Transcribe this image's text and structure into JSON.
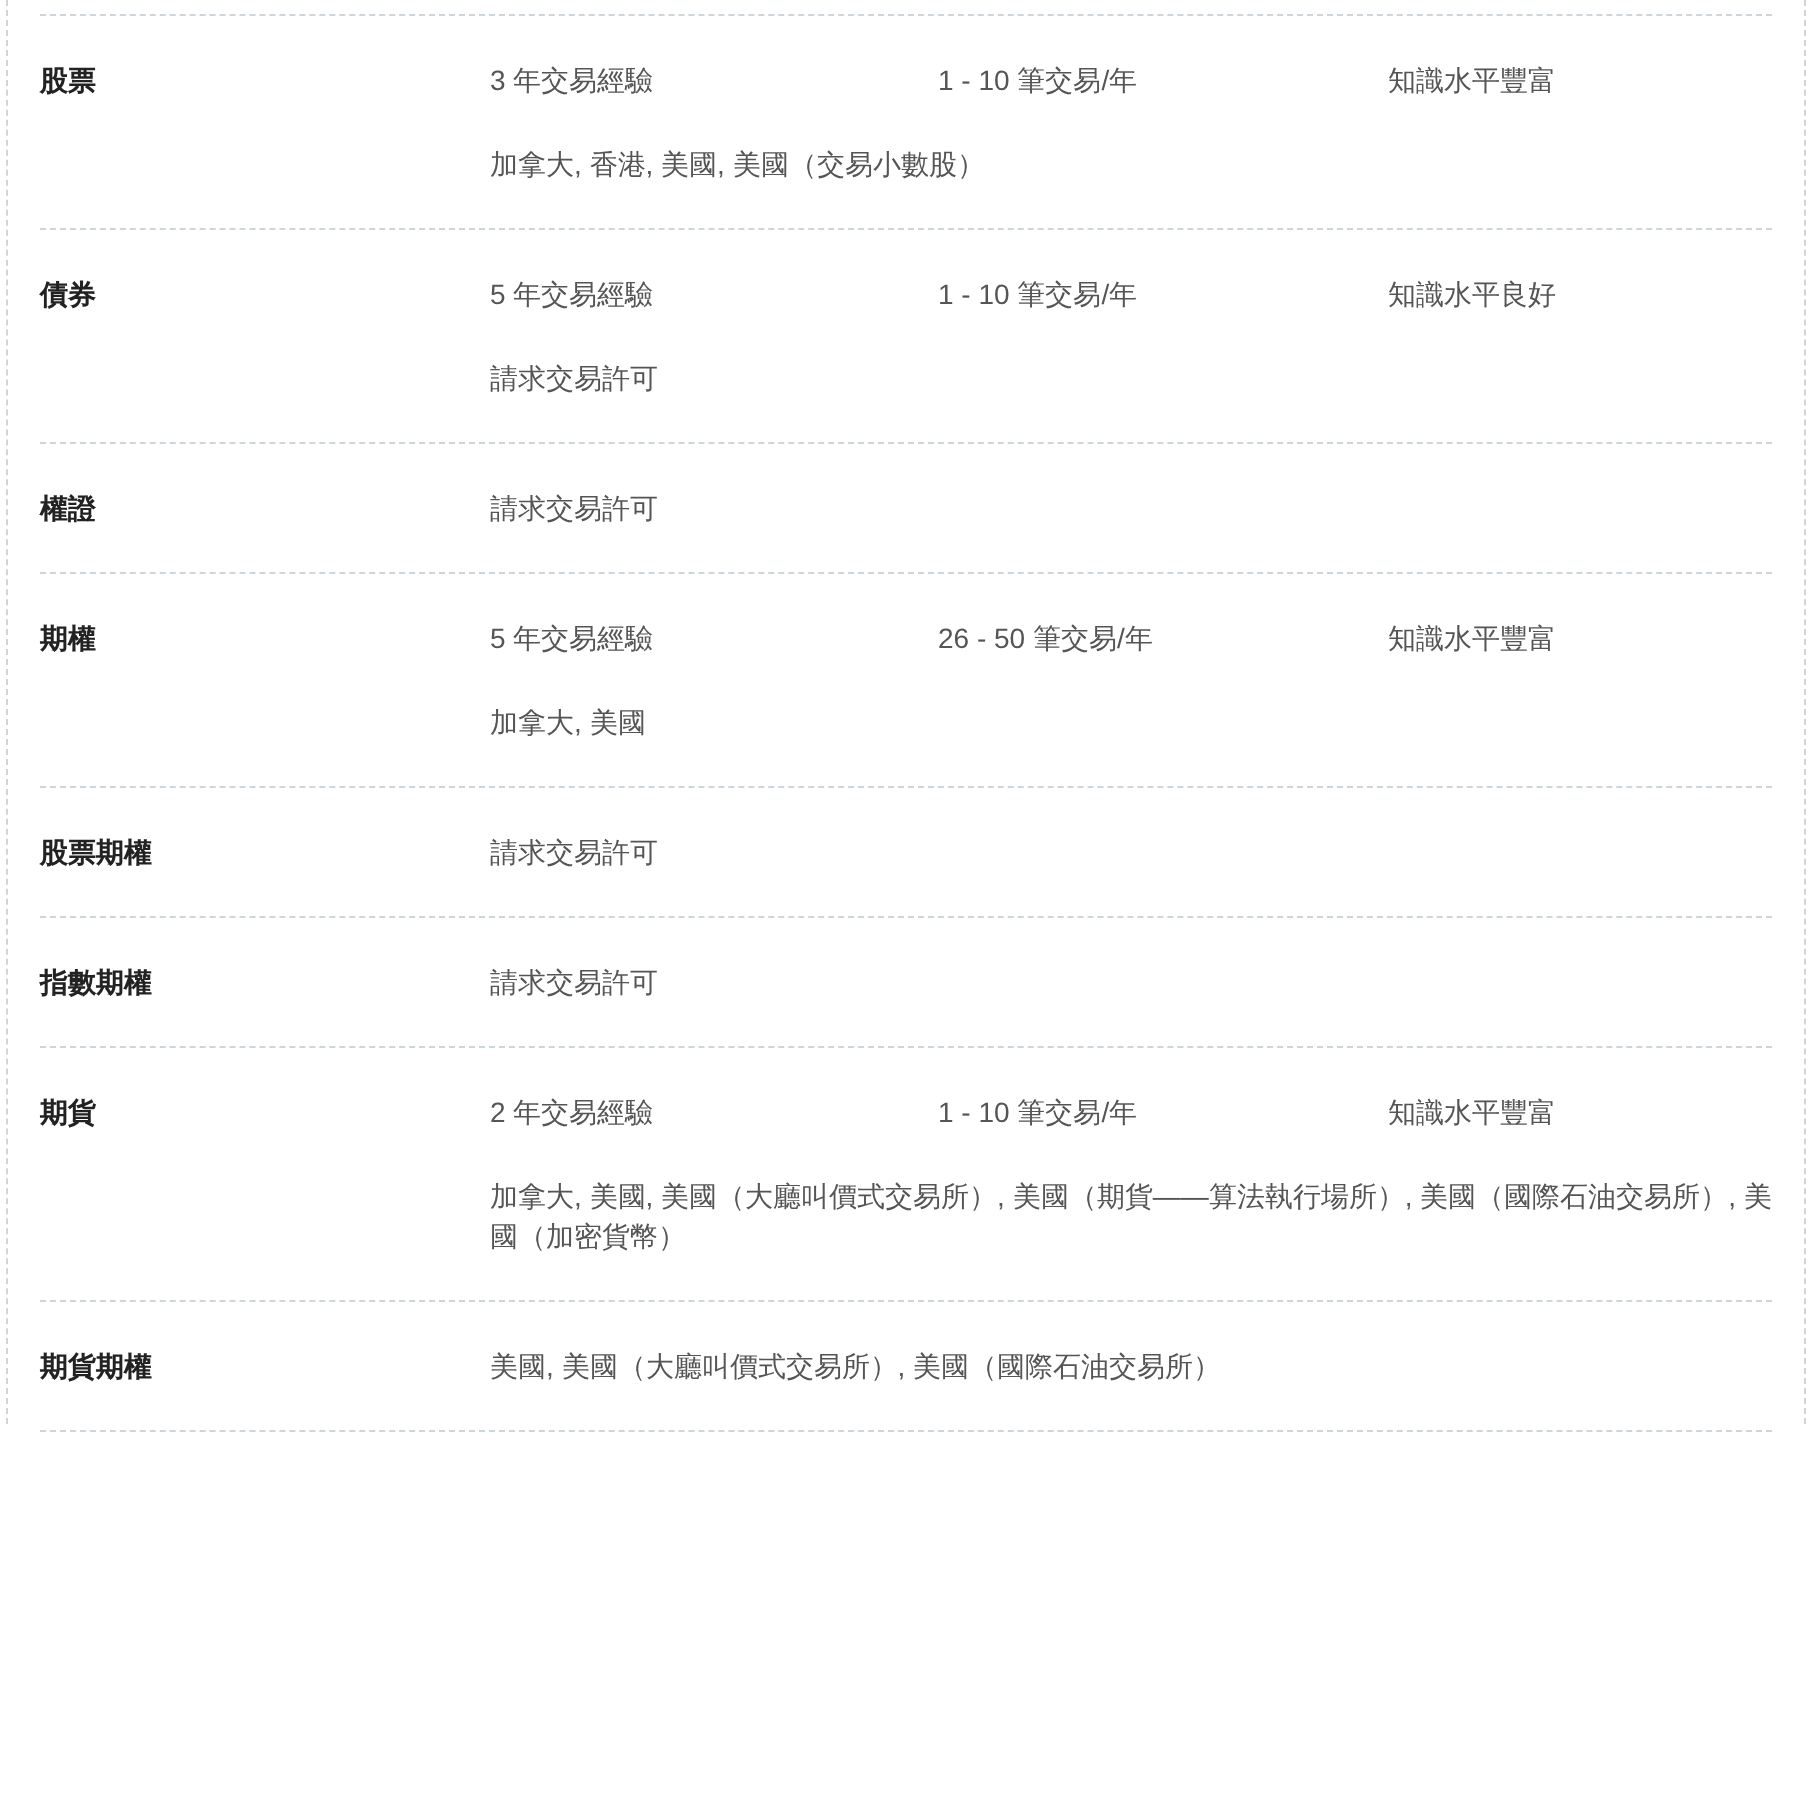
{
  "rows": [
    {
      "product": "股票",
      "cells": [
        "3 年交易經驗",
        "1 - 10 筆交易/年",
        "知識水平豐富"
      ],
      "note": "加拿大, 香港, 美國, 美國（交易小數股）"
    },
    {
      "product": "債券",
      "cells": [
        "5 年交易經驗",
        "1 - 10 筆交易/年",
        "知識水平良好"
      ],
      "note": "請求交易許可"
    },
    {
      "product": "權證",
      "cells": [
        "請求交易許可"
      ]
    },
    {
      "product": "期權",
      "cells": [
        "5 年交易經驗",
        "26 - 50 筆交易/年",
        "知識水平豐富"
      ],
      "note": "加拿大, 美國"
    },
    {
      "product": "股票期權",
      "cells": [
        "請求交易許可"
      ]
    },
    {
      "product": "指數期權",
      "cells": [
        "請求交易許可"
      ]
    },
    {
      "product": "期貨",
      "cells": [
        "2 年交易經驗",
        "1 - 10 筆交易/年",
        "知識水平豐富"
      ],
      "note": "加拿大, 美國, 美國（大廳叫價式交易所）, 美國（期貨——算法執行場所）, 美國（國際石油交易所）, 美國（加密貨幣）"
    },
    {
      "product": "期貨期權",
      "cells": [
        "美國, 美國（大廳叫價式交易所）, 美國（國際石油交易所）"
      ]
    }
  ]
}
